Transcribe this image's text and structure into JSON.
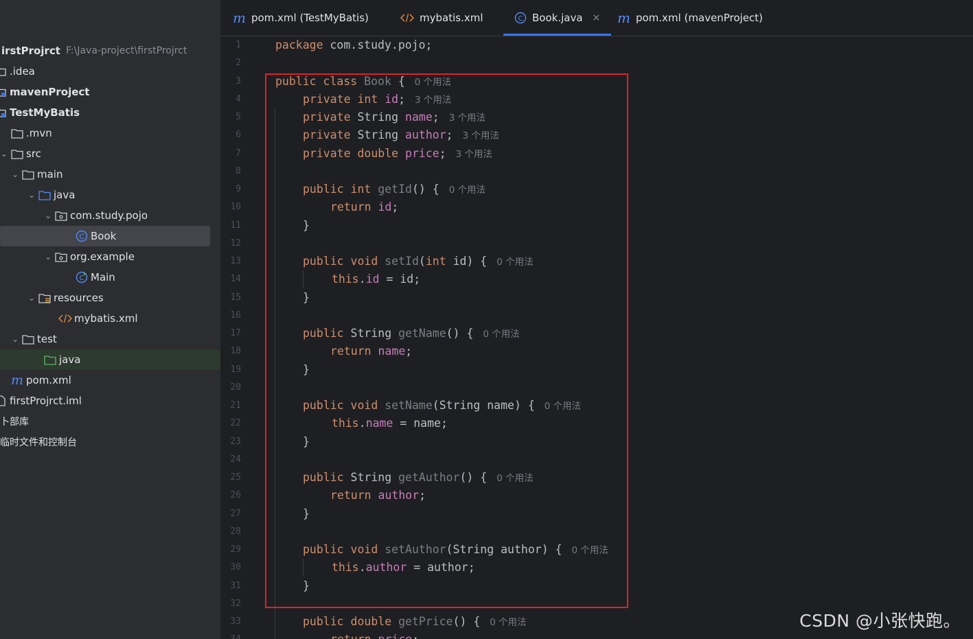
{
  "sidebar": {
    "project_name": "irstProjrct",
    "project_path": "F:\\Java-project\\firstProjrct",
    "items": [
      {
        "label": ".idea",
        "icon": "folder-icon"
      },
      {
        "label": "mavenProject",
        "icon": "module-icon"
      },
      {
        "label": "TestMyBatis",
        "icon": "module-icon"
      },
      {
        "label": ".mvn",
        "icon": "folder-icon"
      },
      {
        "label": "src",
        "icon": "folder-icon"
      },
      {
        "label": "main",
        "icon": "folder-icon"
      },
      {
        "label": "java",
        "icon": "source-folder-icon"
      },
      {
        "label": "com.study.pojo",
        "icon": "package-icon"
      },
      {
        "label": "Book",
        "icon": "class-icon"
      },
      {
        "label": "org.example",
        "icon": "package-icon"
      },
      {
        "label": "Main",
        "icon": "main-class-icon"
      },
      {
        "label": "resources",
        "icon": "resources-folder-icon"
      },
      {
        "label": "mybatis.xml",
        "icon": "xml-icon"
      },
      {
        "label": "test",
        "icon": "folder-icon"
      },
      {
        "label": "java",
        "icon": "test-folder-icon"
      },
      {
        "label": "pom.xml",
        "icon": "maven-icon"
      },
      {
        "label": "firstProjrct.iml",
        "icon": "file-icon"
      },
      {
        "label": "卜部库"
      },
      {
        "label": "临时文件和控制台"
      }
    ]
  },
  "tabs": [
    {
      "label": "pom.xml (TestMyBatis)",
      "icon": "maven-icon"
    },
    {
      "label": "mybatis.xml",
      "icon": "xml-icon"
    },
    {
      "label": "Book.java",
      "icon": "class-icon",
      "active": true
    },
    {
      "label": "pom.xml (mavenProject)",
      "icon": "maven-icon"
    }
  ],
  "tab_close": "×",
  "editor": {
    "line_numbers": [
      "1",
      "2",
      "3",
      "4",
      "5",
      "6",
      "7",
      "8",
      "9",
      "10",
      "11",
      "12",
      "13",
      "14",
      "15",
      "16",
      "17",
      "18",
      "19",
      "20",
      "21",
      "22",
      "23",
      "24",
      "25",
      "26",
      "27",
      "28",
      "29",
      "30",
      "31",
      "32",
      "33",
      "34"
    ],
    "hints": {
      "class": "0 个用法",
      "id": "3 个用法",
      "name": "3 个用法",
      "author": "3 个用法",
      "price": "3 个用法",
      "getId": "0 个用法",
      "setId": "0 个用法",
      "getName": "0 个用法",
      "setName": "0 个用法",
      "getAuthor": "0 个用法",
      "setAuthor": "0 个用法",
      "getPrice": "0 个用法"
    },
    "lines": {
      "l1": {
        "kw": "package",
        "rest": " com.study.pojo;"
      },
      "l3": {
        "kw": "public class",
        "cls": " Book",
        "rest": " {"
      },
      "l4": {
        "kw": "private int",
        "field": " id",
        "rest": ";"
      },
      "l5": {
        "kw": "private",
        "type": " String",
        "field": " name",
        "rest": ";"
      },
      "l6": {
        "kw": "private",
        "type": " String",
        "field": " author",
        "rest": ";"
      },
      "l7": {
        "kw": "private double",
        "field": " price",
        "rest": ";"
      },
      "l9": {
        "kw": "public int",
        "fn": " getId",
        "rest": "() {"
      },
      "l10": {
        "kw": "return",
        "field": " id",
        "rest": ";"
      },
      "l11": {
        "rest": "}"
      },
      "l13": {
        "kw": "public void",
        "fn": " setId",
        "rest": "(",
        "kw2": "int",
        "rest2": " id) {"
      },
      "l14": {
        "kw": "this",
        "dot": ".",
        "field": "id",
        "rest": " = id;"
      },
      "l15": {
        "rest": "}"
      },
      "l17": {
        "kw": "public",
        "type": " String",
        "fn": " getName",
        "rest": "() {"
      },
      "l18": {
        "kw": "return",
        "field": " name",
        "rest": ";"
      },
      "l19": {
        "rest": "}"
      },
      "l21": {
        "kw": "public void",
        "fn": " setName",
        "rest": "(String name) {"
      },
      "l22": {
        "kw": "this",
        "dot": ".",
        "field": "name",
        "rest": " = name;"
      },
      "l23": {
        "rest": "}"
      },
      "l25": {
        "kw": "public",
        "type": " String",
        "fn": " getAuthor",
        "rest": "() {"
      },
      "l26": {
        "kw": "return",
        "field": " author",
        "rest": ";"
      },
      "l27": {
        "rest": "}"
      },
      "l29": {
        "kw": "public void",
        "fn": " setAuthor",
        "rest": "(String author) {"
      },
      "l30": {
        "kw": "this",
        "dot": ".",
        "field": "author",
        "rest": " = author;"
      },
      "l31": {
        "rest": "}"
      },
      "l33": {
        "kw": "public double",
        "fn": " getPrice",
        "rest": "() {"
      },
      "l34": {
        "kw": "return",
        "field": " price",
        "rest": ";"
      }
    }
  },
  "watermark": "CSDN @小张快跑。",
  "colors": {
    "keyword": "#cf8e6d",
    "field": "#c77dbb",
    "function": "#56a8f5",
    "accent": "#3574f0",
    "highlight_box": "#e0202c"
  }
}
